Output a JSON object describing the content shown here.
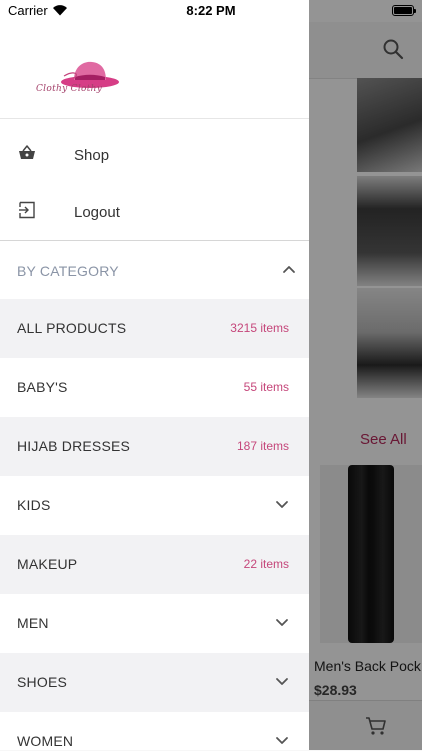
{
  "status_bar": {
    "carrier": "Carrier",
    "time": "8:22 PM"
  },
  "background": {
    "see_all": "See All",
    "product_name": "Men's Back Pock",
    "product_price": "$28.93"
  },
  "drawer": {
    "logo_text": "Clothy Clothy",
    "menu": [
      {
        "label": "Shop",
        "icon": "basket-icon"
      },
      {
        "label": "Logout",
        "icon": "logout-icon"
      }
    ],
    "category_header": "BY CATEGORY",
    "categories": [
      {
        "name": "ALL PRODUCTS",
        "count": "3215 items"
      },
      {
        "name": "BABY'S",
        "count": "55 items"
      },
      {
        "name": "HIJAB DRESSES",
        "count": "187 items"
      },
      {
        "name": "KIDS",
        "expandable": true
      },
      {
        "name": "MAKEUP",
        "count": "22 items"
      },
      {
        "name": "MEN",
        "expandable": true
      },
      {
        "name": "SHOES",
        "expandable": true
      },
      {
        "name": "WOMEN",
        "expandable": true
      }
    ]
  },
  "colors": {
    "accent": "#c5467a",
    "header_text": "#8a94a6",
    "shade_row": "#f2f2f4"
  }
}
